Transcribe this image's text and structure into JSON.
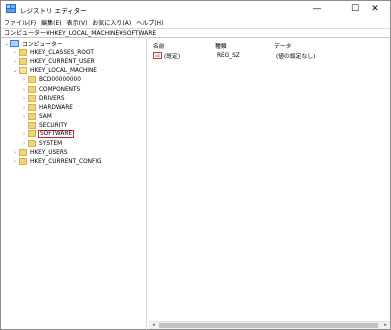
{
  "window": {
    "title": "レジストリ エディター",
    "minimize_glyph": "—",
    "maximize_glyph": "☐",
    "close_glyph": "✕"
  },
  "menu": [
    "ファイル(F)",
    "編集(E)",
    "表示(V)",
    "お気に入り(A)",
    "ヘルプ(H)"
  ],
  "address": "コンピューター¥HKEY_LOCAL_MACHINE¥SOFTWARE",
  "tree": {
    "root": "コンピューター",
    "hives": {
      "classes_root": "HKEY_CLASSES_ROOT",
      "current_user": "HKEY_CURRENT_USER",
      "local_machine": "HKEY_LOCAL_MACHINE",
      "users": "HKEY_USERS",
      "current_config": "HKEY_CURRENT_CONFIG"
    },
    "local_machine_children": {
      "bcd": "BCD00000000",
      "components": "COMPONENTS",
      "drivers": "DRIVERS",
      "hardware": "HARDWARE",
      "sam": "SAM",
      "security": "SECURITY",
      "software": "SOFTWARE",
      "system": "SYSTEM"
    },
    "expanded_arrow": "⌄",
    "collapsed_arrow": "›"
  },
  "list": {
    "columns": {
      "name": "名前",
      "type": "種類",
      "data": "データ"
    },
    "rows": [
      {
        "icon": "ab",
        "name": "(既定)",
        "type": "REG_SZ",
        "data": "(値の設定なし)"
      }
    ]
  },
  "scrollbar": {
    "left_glyph": "◂",
    "right_glyph": "▸"
  }
}
